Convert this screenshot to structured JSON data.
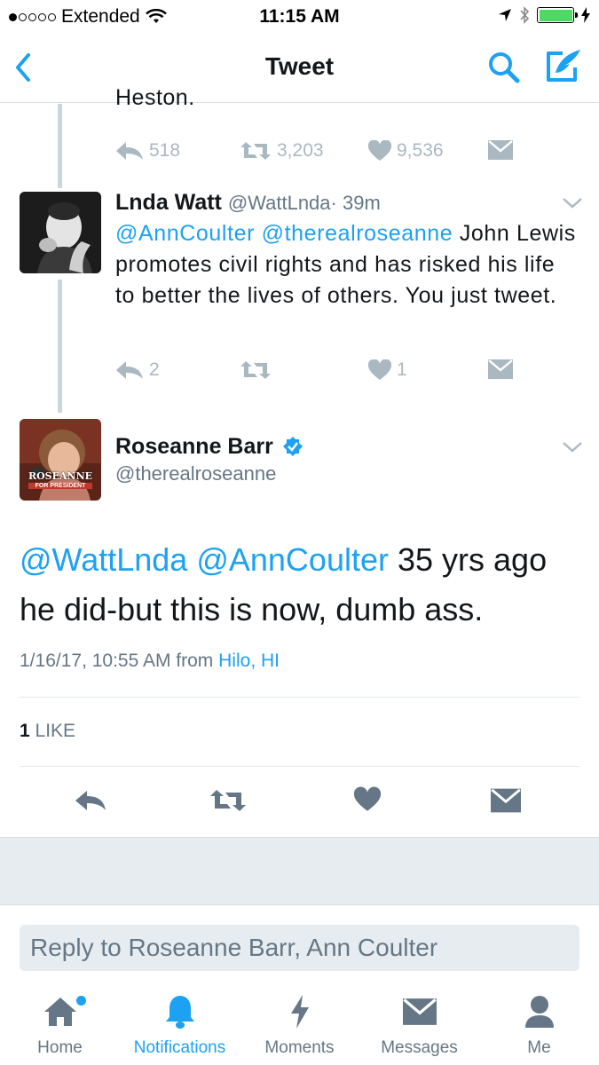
{
  "status_bar": {
    "carrier": "Extended",
    "time": "11:15 AM"
  },
  "nav": {
    "title": "Tweet"
  },
  "previous_tweet": {
    "cut_text": "Heston.",
    "reply_count": "518",
    "retweet_count": "3,203",
    "like_count": "9,536"
  },
  "reply_tweet": {
    "name": "Lnda Watt",
    "handle": "@WattLnda",
    "time": "· 39m",
    "mention1": "@AnnCoulter",
    "mention2": "@therealroseanne",
    "text": " John Lewis promotes civil rights and has risked his life to better the lives of others.  You just tweet.",
    "reply_count": "2",
    "like_count": "1"
  },
  "main_tweet": {
    "name": "Roseanne Barr",
    "handle": "@therealroseanne",
    "avatar_text_top": "ROSEANNE",
    "avatar_text_bottom": "FOR PRESIDENT",
    "mention1": "@WattLnda",
    "mention2": "@AnnCoulter",
    "text": " 35 yrs ago he did-but this is now, dumb ass.",
    "date": "1/16/17, 10:55 AM from",
    "location": "Hilo, HI",
    "like_number": "1",
    "like_word": "LIKE"
  },
  "reply_box": {
    "placeholder": "Reply to Roseanne Barr, Ann Coulter"
  },
  "tabs": [
    {
      "label": "Home",
      "icon": "home-icon"
    },
    {
      "label": "Notifications",
      "icon": "bell-icon"
    },
    {
      "label": "Moments",
      "icon": "lightning-icon"
    },
    {
      "label": "Messages",
      "icon": "envelope-icon"
    },
    {
      "label": "Me",
      "icon": "person-icon"
    }
  ],
  "colors": {
    "accent": "#1da1f2",
    "action_gray": "#aab8c2",
    "secondary_text": "#657786",
    "battery": "#4cd964"
  }
}
